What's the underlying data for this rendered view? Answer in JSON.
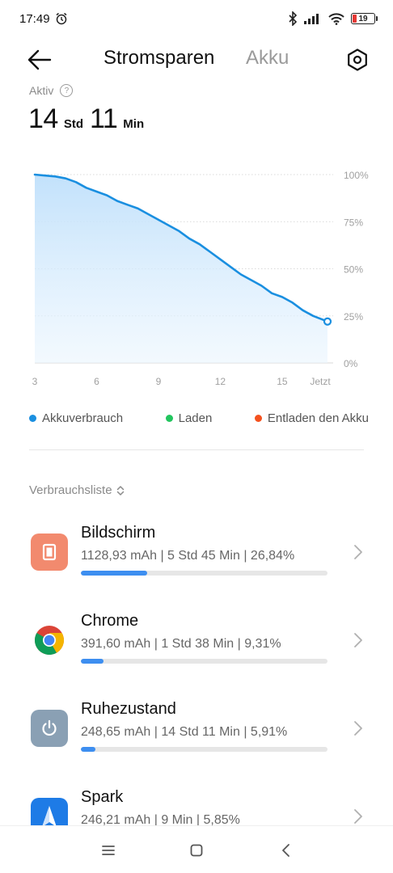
{
  "status_bar": {
    "time": "17:49",
    "battery_level": "19",
    "icons": [
      "alarm-icon",
      "bluetooth-icon",
      "signal-icon",
      "wifi-icon",
      "battery-icon"
    ]
  },
  "header": {
    "tab_active": "Stromsparen",
    "tab_inactive": "Akku"
  },
  "active": {
    "label": "Aktiv",
    "help": "?",
    "hours": "14",
    "hours_unit": "Std",
    "minutes": "11",
    "minutes_unit": "Min"
  },
  "chart_data": {
    "type": "area",
    "x": [
      3,
      3.5,
      4,
      4.5,
      5,
      5.5,
      6,
      6.5,
      7,
      7.5,
      8,
      8.5,
      9,
      9.5,
      10,
      10.5,
      11,
      11.5,
      12,
      12.5,
      13,
      13.5,
      14,
      14.5,
      15,
      15.5,
      16,
      16.5,
      17.2
    ],
    "values": [
      100,
      99.5,
      99,
      98,
      96,
      93,
      91,
      89,
      86,
      84,
      82,
      79,
      76,
      73,
      70,
      66,
      63,
      59,
      55,
      51,
      47,
      44,
      41,
      37,
      35,
      32,
      28,
      25,
      22
    ],
    "x_tick_labels": [
      "3",
      "6",
      "9",
      "12",
      "15",
      "Jetzt"
    ],
    "x_ticks": [
      3,
      6,
      9,
      12,
      15,
      17.2
    ],
    "y_tick_labels": [
      "100%",
      "75%",
      "50%",
      "25%",
      "0%"
    ],
    "y_ticks": [
      100,
      75,
      50,
      25,
      0
    ],
    "xlim": [
      3,
      17.2
    ],
    "ylim": [
      0,
      100
    ],
    "line_color": "#1a8fe0",
    "grid": true
  },
  "legend": [
    {
      "label": "Akkuverbrauch",
      "color": "#1a8fe0"
    },
    {
      "label": "Laden",
      "color": "#22c55e"
    },
    {
      "label": "Entladen den Akku",
      "color": "#f4511e"
    }
  ],
  "list": {
    "title": "Verbrauchsliste",
    "items": [
      {
        "name": "Bildschirm",
        "detail": "1128,93 mAh | 5 Std 45 Min  | 26,84%",
        "percent": 26.84,
        "icon": "screen-icon",
        "icon_bg": "#f28a6e"
      },
      {
        "name": "Chrome",
        "detail": "391,60 mAh | 1 Std 38 Min  | 9,31%",
        "percent": 9.31,
        "icon": "chrome-icon",
        "icon_bg": "#ffffff"
      },
      {
        "name": "Ruhezustand",
        "detail": "248,65 mAh | 14 Std 11 Min  | 5,91%",
        "percent": 5.91,
        "icon": "power-icon",
        "icon_bg": "#8aa0b4"
      },
      {
        "name": "Spark",
        "detail": "246,21 mAh | 9 Min  | 5,85%",
        "percent": 5.85,
        "icon": "spark-icon",
        "icon_bg": "#1e7be6"
      }
    ]
  },
  "nav": {
    "icons": [
      "menu-icon",
      "home-icon",
      "back-icon"
    ]
  }
}
